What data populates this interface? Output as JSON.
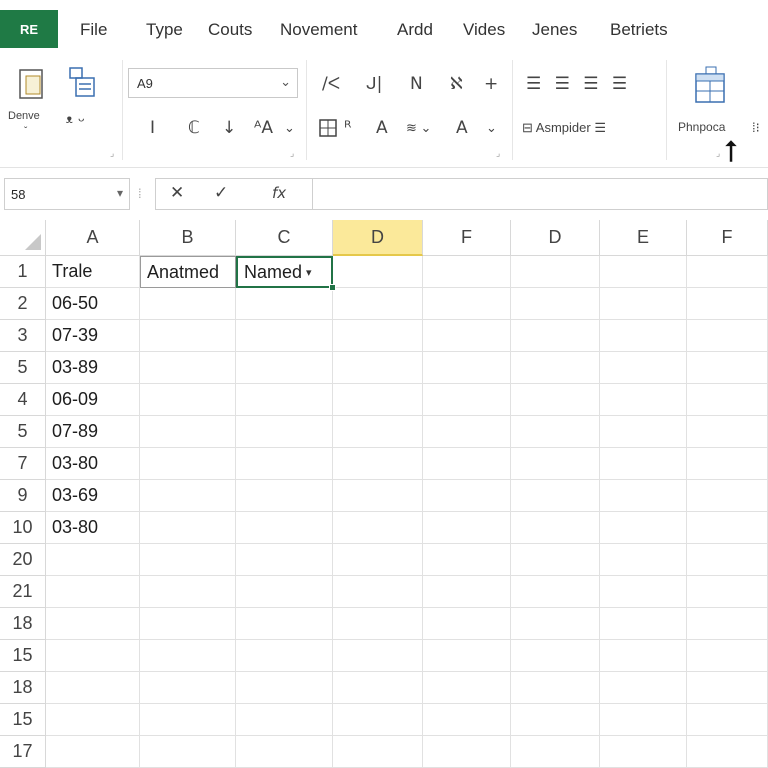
{
  "app": {
    "badge": "RE"
  },
  "menu": [
    "File",
    "Type",
    "Couts",
    "Novement",
    "Ardd",
    "Vides",
    "Jenes",
    "Betriets"
  ],
  "ribbon": {
    "paste_label": "Denve",
    "font_name": "A9",
    "font_style_buttons": [
      "I",
      "ℂ",
      "↓",
      "ᴬA"
    ],
    "alignment_row1": [
      "/ᐸ",
      "ᒍ|",
      "N",
      "ℵ",
      "+"
    ],
    "alignment_row2": [
      "B",
      "A",
      "A"
    ],
    "wrap_text_label": "Asmpider",
    "styles_label": "Phnpoca"
  },
  "formula_bar": {
    "name_box": "58",
    "fx_symbols": [
      "✕",
      "✓",
      "fx"
    ]
  },
  "grid": {
    "columns": [
      "A",
      "B",
      "C",
      "D",
      "F",
      "D",
      "E",
      "F"
    ],
    "active_column": 3,
    "row_numbers": [
      "1",
      "2",
      "3",
      "5",
      "4",
      "5",
      "7",
      "9",
      "10",
      "20",
      "21",
      "18",
      "15",
      "18",
      "15",
      "17"
    ],
    "cells": {
      "A": [
        "Trale",
        "06-50",
        "07-39",
        "03-89",
        "06-09",
        "07-89",
        "03-80",
        "03-69",
        "03-80"
      ],
      "B1": "Anatmed",
      "C1": "Named"
    }
  },
  "colors": {
    "brand": "#1f7a45",
    "selection": "#217346",
    "active_header": "#fbe99a"
  }
}
